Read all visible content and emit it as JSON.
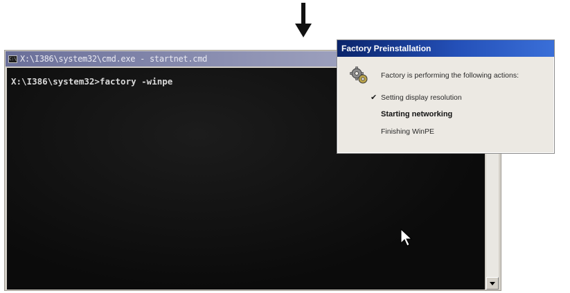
{
  "console": {
    "title": "X:\\I386\\system32\\cmd.exe - startnet.cmd",
    "icon_label": "C:\\",
    "prompt_line": "X:\\I386\\system32>factory -winpe"
  },
  "dialog": {
    "title": "Factory Preinstallation",
    "message": "Factory is performing the following actions:",
    "steps": [
      {
        "label": "Setting display resolution",
        "status": "done"
      },
      {
        "label": "Starting networking",
        "status": "current"
      },
      {
        "label": "Finishing WinPE",
        "status": "pending"
      }
    ],
    "check_glyph": "✔"
  },
  "icons": {
    "annotation_arrow": "down-arrow-icon",
    "dialog_icon": "gear-icon",
    "pointer": "mouse-pointer-icon",
    "scroll": "scroll-down-arrow-icon"
  },
  "colors": {
    "console_bg": "#101010",
    "console_text": "#d8d8d8",
    "dialog_title_bg": "#0a246a",
    "dialog_bg": "#ece9e3"
  }
}
